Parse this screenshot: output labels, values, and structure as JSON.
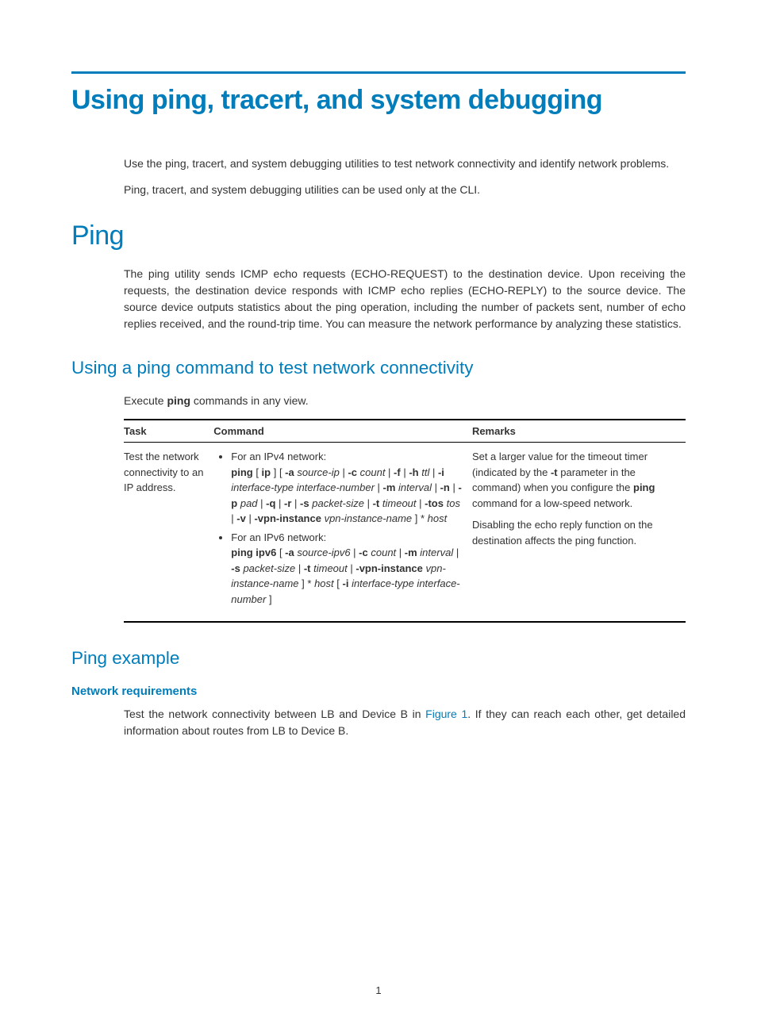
{
  "title": "Using ping, tracert, and system debugging",
  "intro": {
    "p1": "Use the ping, tracert, and system debugging utilities to test network connectivity and identify network problems.",
    "p2": "Ping, tracert, and system debugging utilities can be used only at the CLI."
  },
  "ping": {
    "heading": "Ping",
    "p1": "The ping utility sends ICMP echo requests (ECHO-REQUEST) to the destination device. Upon receiving the requests, the destination device responds with ICMP echo replies (ECHO-REPLY) to the source device. The source device outputs statistics about the ping operation, including the number of packets sent, number of echo replies received, and the round-trip time. You can measure the network performance by analyzing these statistics."
  },
  "usingPing": {
    "heading": "Using a ping command to test network connectivity",
    "intro_pre": "Execute ",
    "intro_cmd": "ping",
    "intro_post": " commands in any view."
  },
  "table": {
    "headers": {
      "task": "Task",
      "command": "Command",
      "remarks": "Remarks"
    },
    "row": {
      "task": "Test the network connectivity to an IP address.",
      "ipv4_label": "For an IPv4 network:",
      "ipv4_cmd": {
        "p1": "ping",
        "p2": "ip",
        "p3": "-a",
        "p4": "source-ip",
        "p5": "-c",
        "p6": "count",
        "p7": "-f",
        "p8": "-h",
        "p9": "ttl",
        "p10": "-i",
        "p11": "interface-type interface-number",
        "p12": "-m",
        "p13": "interval",
        "p14": "-n",
        "p15": "-p",
        "p16": "pad",
        "p17": "-q",
        "p18": "-r",
        "p19": "-s",
        "p20": "packet-size",
        "p21": "-t",
        "p22": "timeout",
        "p23": "-tos",
        "p24": "tos",
        "p25": "-v",
        "p26": "-vpn-instance",
        "p27": "vpn-instance-name",
        "p28": "host"
      },
      "ipv6_label": "For an IPv6 network:",
      "ipv6_cmd": {
        "p1": "ping ipv6",
        "p2": "-a",
        "p3": "source-ipv6",
        "p4": "-c",
        "p5": "count",
        "p6": "-m",
        "p7": "interval",
        "p8": "-s",
        "p9": "packet-size",
        "p10": "-t",
        "p11": "timeout",
        "p12": "-vpn-instance",
        "p13": "vpn-instance-name",
        "p14": "host",
        "p15": "-i",
        "p16": "interface-type interface-number"
      },
      "remarks": {
        "r1a": "Set a larger value for the timeout timer (indicated by the ",
        "r1b": "-t",
        "r1c": " parameter in the command) when you configure the ",
        "r1d": "ping",
        "r1e": " command for a low-speed network.",
        "r2": "Disabling the echo reply function on the destination affects the ping function."
      }
    }
  },
  "pingExample": {
    "heading": "Ping example",
    "sub": "Network requirements",
    "p_pre": "Test the network connectivity between LB and Device B in ",
    "p_link": "Figure 1",
    "p_post": ". If they can reach each other, get detailed information about routes from LB to Device B."
  },
  "pageNumber": "1"
}
